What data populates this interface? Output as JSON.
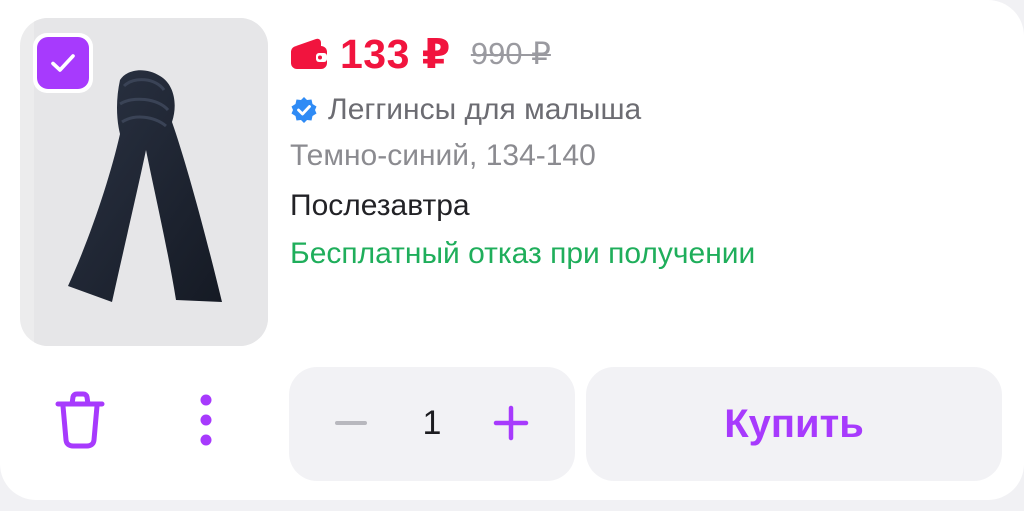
{
  "product": {
    "price": "133 ₽",
    "old_price": "990 ₽",
    "title": "Леггинсы для малыша",
    "variant": "Темно-синий, 134-140",
    "delivery": "Послезавтра",
    "free_return": "Бесплатный отказ при получении",
    "selected": true,
    "image_icon": "scarf-product-image"
  },
  "actions": {
    "delete_icon": "trash-icon",
    "more_icon": "more-vertical-icon",
    "quantity": "1",
    "buy_label": "Купить"
  },
  "colors": {
    "accent": "#a73afd",
    "price": "#f1143e",
    "success": "#1fae5b",
    "verified": "#2f8bf5"
  }
}
